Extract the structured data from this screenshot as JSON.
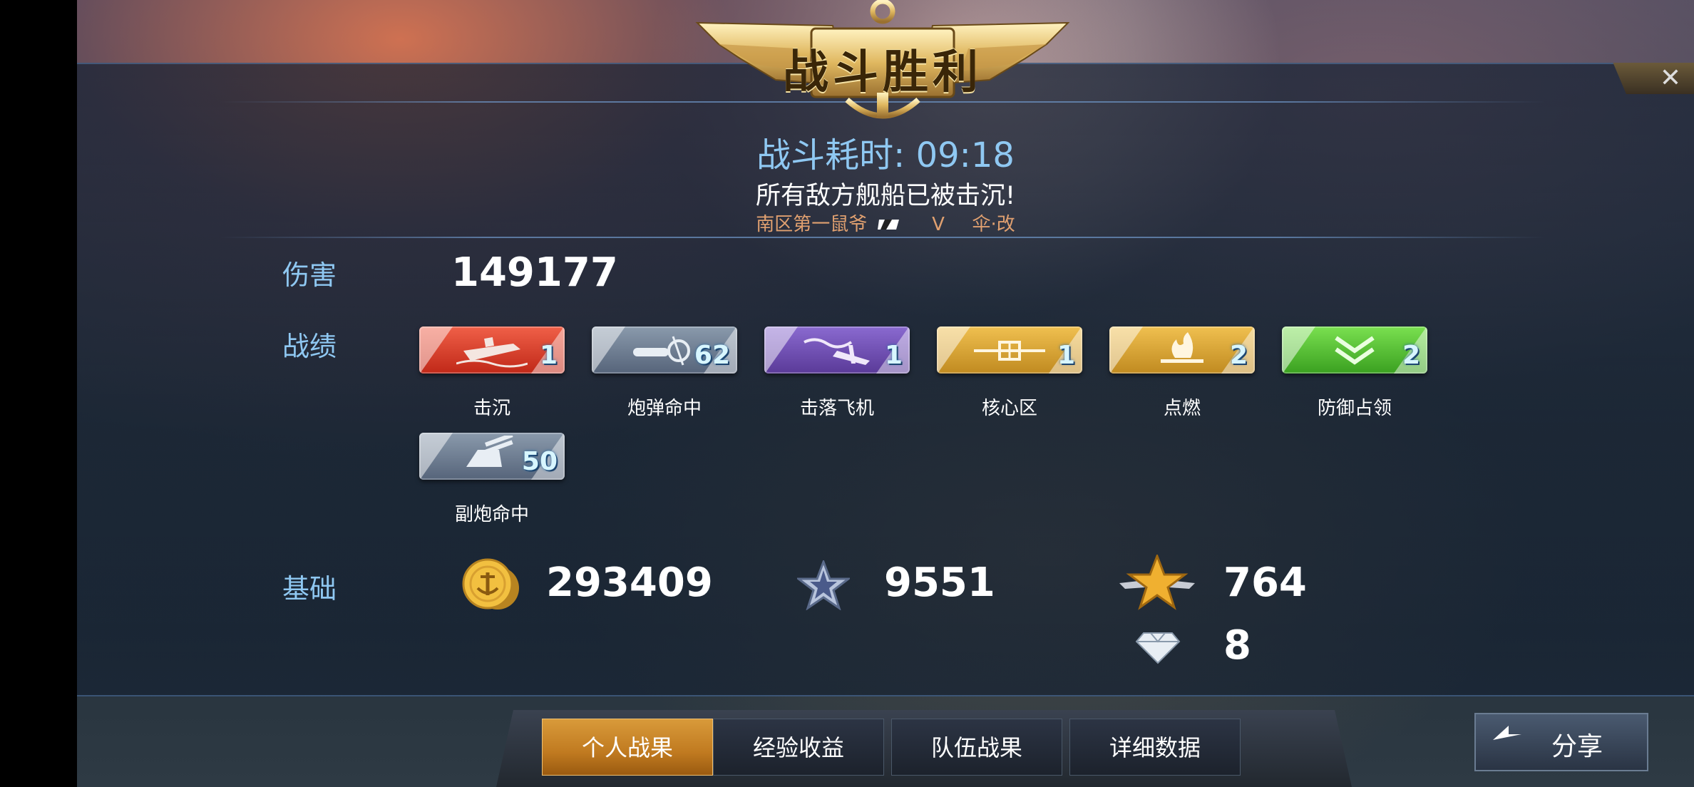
{
  "header": {
    "title": "战斗胜利",
    "close_label": "✕"
  },
  "battle": {
    "time_label": "战斗耗时:",
    "time_value": "09:18",
    "result": "所有敌方舰船已被击沉!",
    "player_name": "南区第一鼠爷",
    "player_rank": "V",
    "ship_name": "伞·改"
  },
  "damage": {
    "label": "伤害",
    "value": "149177"
  },
  "achievements": {
    "label": "战绩",
    "items": [
      {
        "label": "击沉",
        "count": "1",
        "color": "#d8402a",
        "icon": "sinking-ship-icon"
      },
      {
        "label": "炮弹命中",
        "count": "62",
        "color": "#6a7a8c",
        "icon": "shell-hit-icon"
      },
      {
        "label": "击落飞机",
        "count": "1",
        "color": "#6a4aa8",
        "icon": "plane-down-icon"
      },
      {
        "label": "核心区",
        "count": "1",
        "color": "#d8a030",
        "icon": "citadel-icon"
      },
      {
        "label": "点燃",
        "count": "2",
        "color": "#d8a030",
        "icon": "fire-icon"
      },
      {
        "label": "防御占领",
        "count": "2",
        "color": "#5ac83a",
        "icon": "defend-chevron-icon"
      },
      {
        "label": "副炮命中",
        "count": "50",
        "color": "#6a7a8c",
        "icon": "secondary-gun-icon"
      }
    ]
  },
  "basics": {
    "label": "基础",
    "coins": "293409",
    "experience": "9551",
    "free_experience": "764",
    "diamonds": "8"
  },
  "tabs": [
    {
      "label": "个人战果",
      "active": true
    },
    {
      "label": "经验收益",
      "active": false
    },
    {
      "label": "队伍战果",
      "active": false
    },
    {
      "label": "详细数据",
      "active": false
    }
  ],
  "share_label": "分享"
}
